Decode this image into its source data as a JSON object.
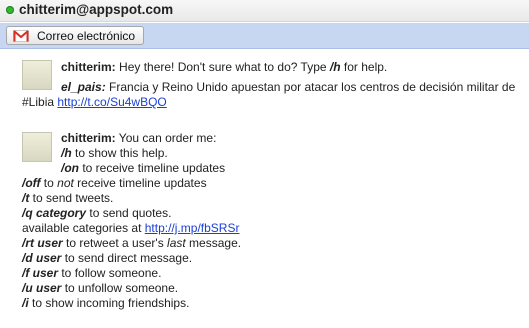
{
  "window": {
    "title": "chitterim@appspot.com",
    "status_color": "#33b633"
  },
  "toolbar": {
    "email_button_label": "Correo electrónico",
    "email_icon": "gmail-icon"
  },
  "messages": [
    {
      "sender": "chitterim:",
      "text": " Hey there! Don't sure what to do? Type ",
      "cmd": "/h",
      "text_end": " for help.",
      "tweet": {
        "author": "el_pais:",
        "text": " Francia y Reino Unido apuestan por atacar los centros de decisión militar de",
        "hashtag": "#Libia ",
        "link": "http://t.co/Su4wBQO"
      }
    },
    {
      "sender": "chitterim:",
      "intro": " You can order me:",
      "help": [
        {
          "cmd": "/h",
          "pre": "",
          "em": "",
          "post": " to show this help."
        },
        {
          "cmd": "/on",
          "pre": "",
          "em": "",
          "post": " to receive timeline updates"
        },
        {
          "cmd": "/off",
          "pre": " to ",
          "em": "not",
          "post": " receive timeline updates"
        },
        {
          "cmd": "/t",
          "pre": "",
          "em": "",
          "post": " to send tweets."
        },
        {
          "cmd": "/q category",
          "pre": "",
          "em": "",
          "post": " to send quotes."
        }
      ],
      "categories_text": "available categories at ",
      "categories_link": "http://j.mp/fbSRSr",
      "help2": [
        {
          "cmd": "/rt user",
          "pre": " to retweet a user's ",
          "em": "last",
          "post": " message."
        },
        {
          "cmd": "/d user",
          "pre": "",
          "em": "",
          "post": " to send direct message."
        },
        {
          "cmd": "/f user",
          "pre": "",
          "em": "",
          "post": " to follow someone."
        },
        {
          "cmd": "/u user",
          "pre": "",
          "em": "",
          "post": " to unfollow someone."
        },
        {
          "cmd": "/i",
          "pre": "",
          "em": "",
          "post": " to show incoming friendships."
        }
      ]
    }
  ]
}
